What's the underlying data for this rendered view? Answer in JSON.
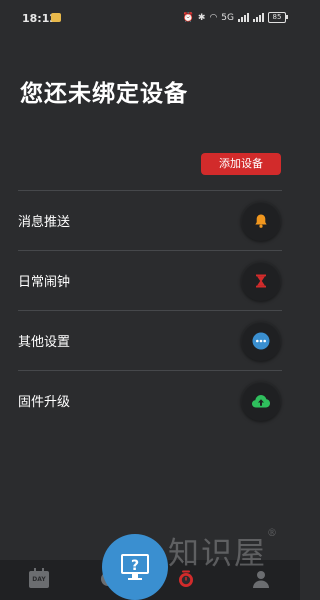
{
  "status_bar": {
    "time": "18:12",
    "network_label": "5G",
    "battery": "85"
  },
  "page": {
    "title": "您还未绑定设备",
    "add_device_button": "添加设备"
  },
  "menu": [
    {
      "label": "消息推送",
      "icon": "bell-icon",
      "icon_color": "#f0961e"
    },
    {
      "label": "日常闹钟",
      "icon": "hourglass-icon",
      "icon_color": "#d22b2b"
    },
    {
      "label": "其他设置",
      "icon": "more-dots-icon",
      "icon_color": "#3a8fd0"
    },
    {
      "label": "固件升级",
      "icon": "cloud-upload-icon",
      "icon_color": "#2fbf5d"
    }
  ],
  "bottom_nav": {
    "day_label": "DAY"
  },
  "watermark": {
    "text": "知识屋",
    "mark": "®"
  },
  "colors": {
    "background": "#2b2c2e",
    "accent_red": "#d22b2b",
    "divider": "#46484b"
  }
}
